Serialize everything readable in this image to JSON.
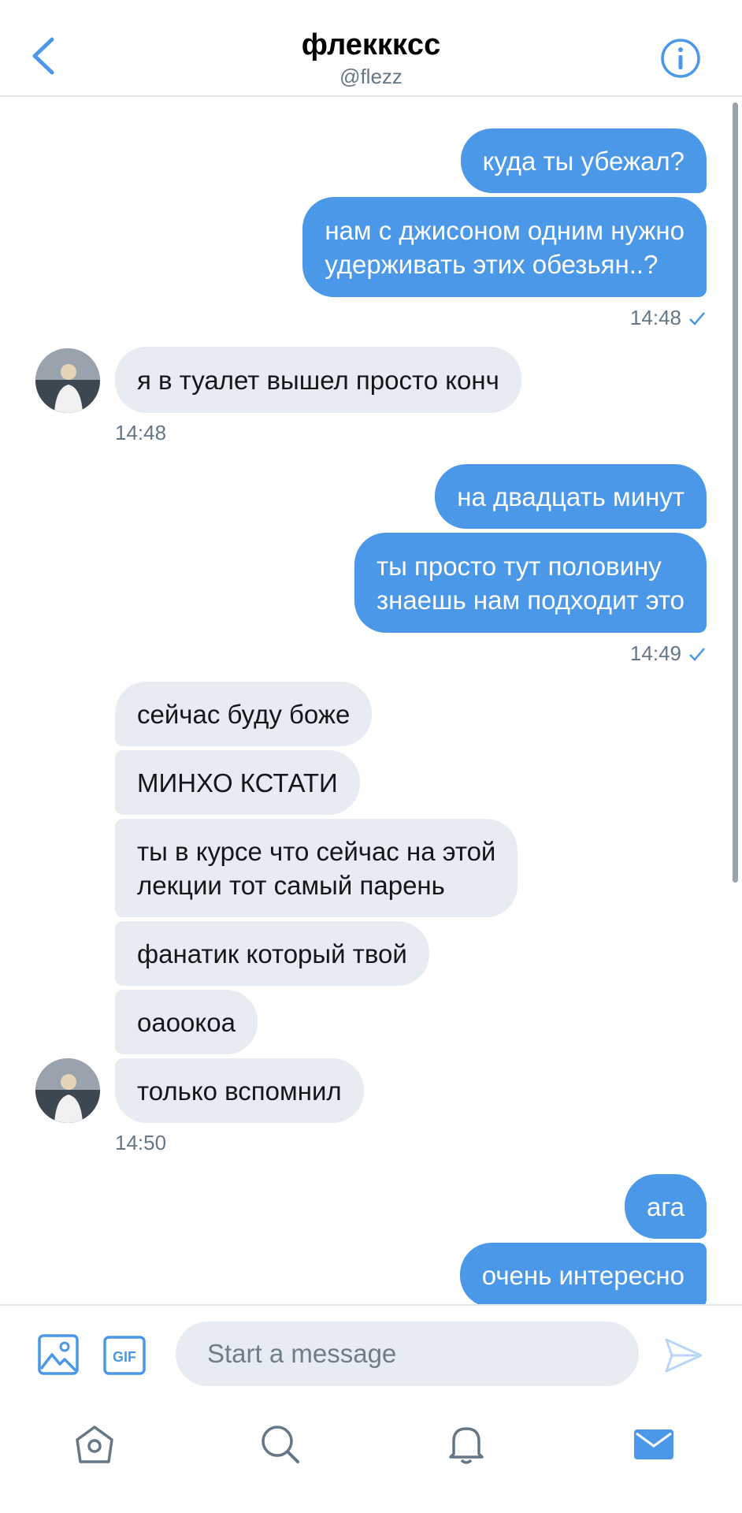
{
  "header": {
    "title": "флекккcс",
    "handle": "@flezz"
  },
  "messages": {
    "m1": "куда ты убежал?",
    "m2": "нам с джисоном одним нужно\nудерживать этих обезьян..?",
    "t1": "14:48",
    "m3": "я в туалет вышел просто конч",
    "t2": "14:48",
    "m4": "на двадцать минут",
    "m5": "ты просто тут половину\nзнаешь нам подходит это",
    "t3": "14:49",
    "m6": "сейчас буду боже",
    "m7": "МИНХО КСТАТИ",
    "m8": "ты в курсе что сейчас на этой\nлекции тот самый парень",
    "m9": "фанатик который твой",
    "m10": "оаоокоа",
    "m11": "только вспомнил",
    "t4": "14:50",
    "m12": "ага",
    "m13": "очень интересно"
  },
  "composer": {
    "placeholder": "Start a message",
    "gif_label": "GIF"
  },
  "icons": {
    "back": "chevron-left-icon",
    "info": "info-icon",
    "media": "image-icon",
    "gif": "gif-icon",
    "send": "send-icon",
    "home": "home-icon",
    "search": "search-icon",
    "notifications": "bell-icon",
    "messages": "mail-icon"
  },
  "colors": {
    "accent": "#4b98e8",
    "incoming_bubble": "#e6ecf1",
    "muted_text": "#657786"
  }
}
